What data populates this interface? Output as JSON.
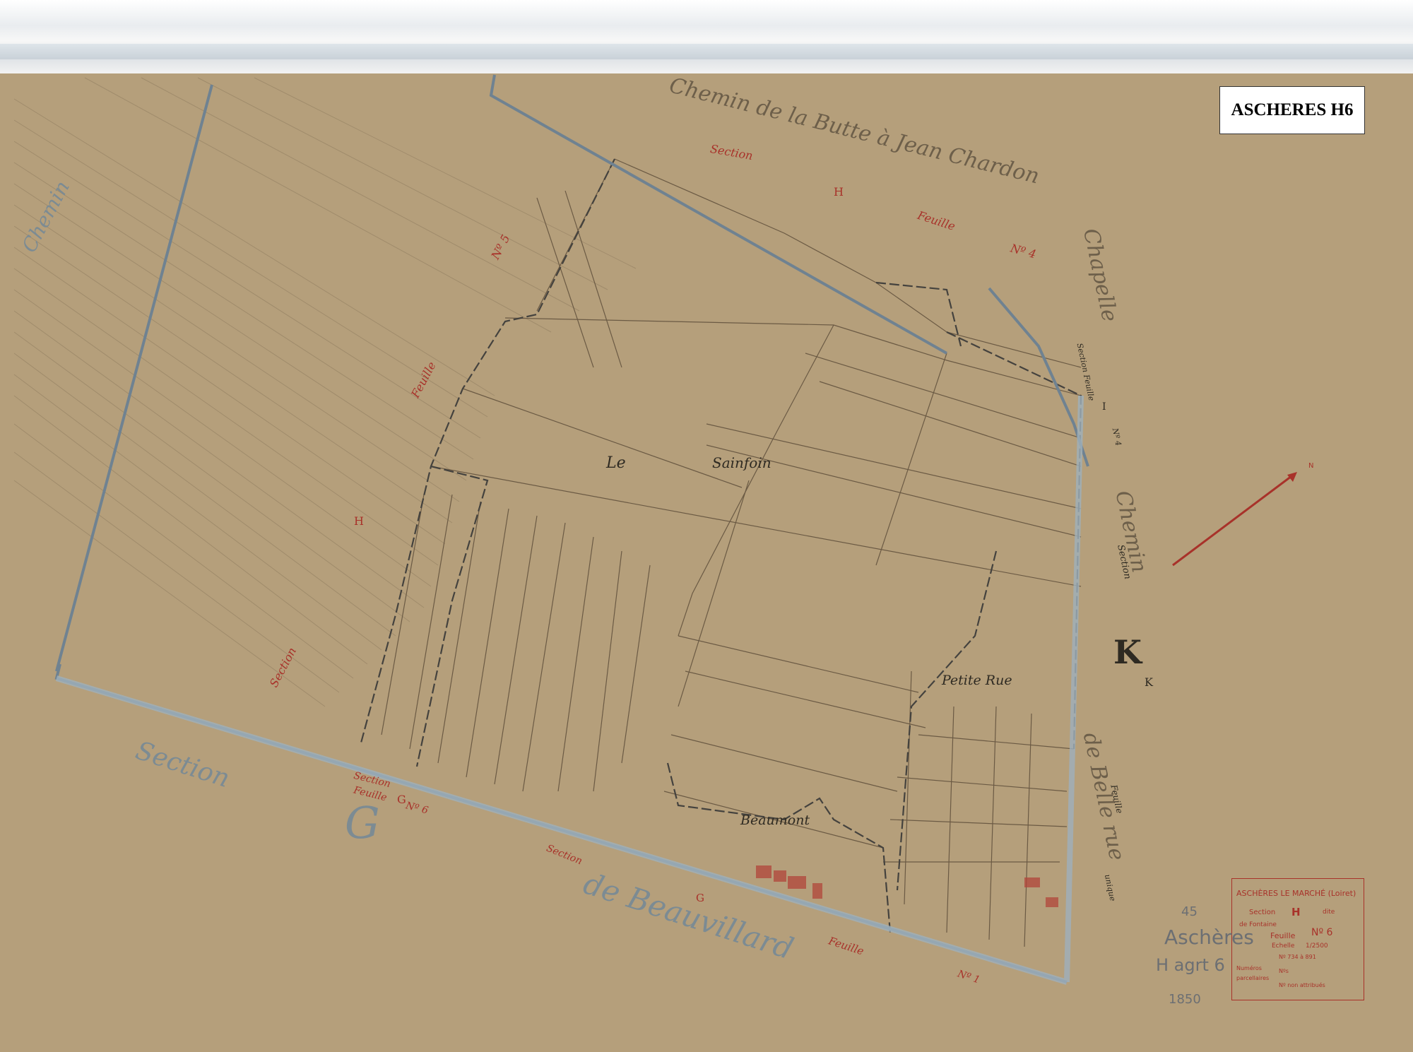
{
  "stamp": {
    "label": "ASCHERES H6"
  },
  "places": {
    "le": "Le",
    "sainfoin": "Sainfoin",
    "petite_rue": "Petite Rue",
    "beaumont": "Beaumont"
  },
  "section_letters": {
    "H_top": "H",
    "H_left": "H",
    "I": "I",
    "K_big": "K",
    "K_small": "K",
    "G_big": "G",
    "G_red": "G",
    "G_bottom": "G"
  },
  "section_words": {
    "section_top": "Section",
    "feuille_top": "Feuille",
    "nr4": "Nº 4",
    "feuille_left": "Feuille",
    "nr5": "Nº 5",
    "section_left": "Section",
    "section_feuille_I": "Section Feuille",
    "nr4_I": "Nº 4",
    "section_K": "Section",
    "feuille_K": "Feuille",
    "unique": "unique",
    "section_g": "Section",
    "feuille_g": "Feuille",
    "nr6_g": "Nº 6",
    "section_bottom": "Section",
    "feuille_bottom": "Feuille",
    "nr1": "Nº 1"
  },
  "roads": {
    "chemin_top": "Chemin de la Butte à Jean Chardon",
    "chapelle": "Chapelle",
    "chemin_right": "de Belle rue",
    "chemin_k": "Chemin",
    "beauvillard": "de Beauvillard",
    "section_blue": "Section",
    "g_blue": "G",
    "left_edge": "Chemin"
  },
  "cartouche": {
    "title": "ASCHÈRES LE MARCHÉ (Loiret)",
    "section_label": "Section",
    "section_letter": "H",
    "dite": "dite",
    "de_fontaine": "de Fontaine",
    "feuille": "Feuille",
    "num": "Nº 6",
    "echelle": "Echelle",
    "scale": "1/2500",
    "line1": "Nº 734 à 891",
    "numeros": "Numéros",
    "parcellaires": "parcellaires",
    "nos": "Nºs",
    "line3": "Nº non attribués"
  },
  "graphite": {
    "num45": "45",
    "aschères": "Aschères",
    "h_agr": "H agrt 6",
    "year": "1850"
  },
  "colors": {
    "paper": "#b59f7b",
    "boundary_blue": "#6f8291",
    "parcel_line": "#6b5a44",
    "ink_red": "#a8322a"
  },
  "icons": {
    "north_arrow": "north-arrow-icon"
  }
}
